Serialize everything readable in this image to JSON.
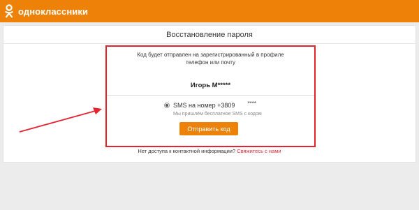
{
  "header": {
    "logo_icon": "odnoklassniki-icon",
    "logo_text": "одноклассники",
    "color": "#ee8208"
  },
  "card": {
    "title": "Восстановление пароля"
  },
  "recovery": {
    "description": "Код будет отправлен на зарегистрированный в профиле телефон или почту",
    "user_name": "Игорь М*****",
    "sms_label": "SMS на номер +3809",
    "sms_mask": "****",
    "sms_subtext": "Мы пришлём бесплатное SMS с кодом",
    "send_button": "Отправить код",
    "selected": true
  },
  "footer": {
    "question": "Нет доступа к контактной информации?",
    "link": "Свяжитесь с нами"
  },
  "annotation": {
    "highlight_color": "#e5232e",
    "arrow_icon": "arrow-icon"
  }
}
